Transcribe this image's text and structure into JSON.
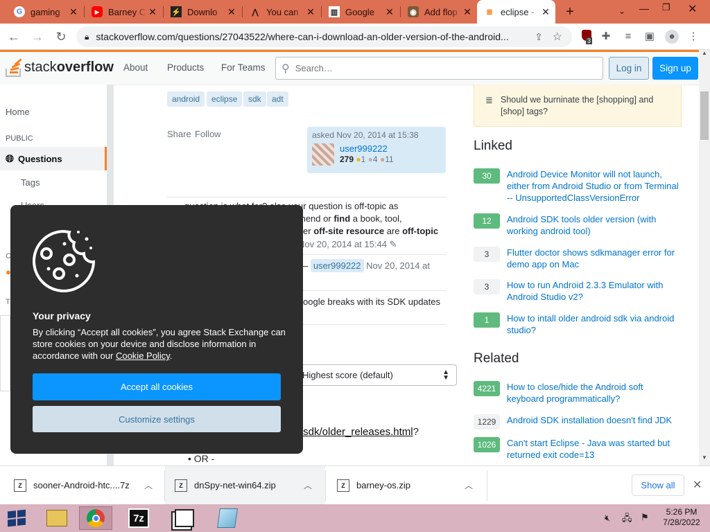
{
  "tabs": [
    {
      "title": "gaming",
      "fav": "G",
      "favcolor": "#4285f4"
    },
    {
      "title": "Barney C",
      "fav": "▶",
      "favcolor": "#ff0000"
    },
    {
      "title": "Downlo",
      "fav": "⚡",
      "favcolor": "#222"
    },
    {
      "title": "You can",
      "fav": "⋀",
      "favcolor": "#222"
    },
    {
      "title": "Google",
      "fav": "▥",
      "favcolor": "#222"
    },
    {
      "title": "Add flop",
      "fav": "◉",
      "favcolor": "#222"
    },
    {
      "title": "eclipse -",
      "fav": "≣",
      "favcolor": "#f48225",
      "active": true
    }
  ],
  "address": {
    "url": "stackoverflow.com/questions/27043522/where-can-i-download-an-older-version-of-the-android...",
    "ext_badge": "3"
  },
  "header": {
    "about": "About",
    "products": "Products",
    "teams": "For Teams",
    "search_placeholder": "Search…",
    "login": "Log in",
    "signup": "Sign up",
    "logo_light": "stack",
    "logo_bold": "overflow"
  },
  "leftnav": {
    "home": "Home",
    "public": "PUBLIC",
    "questions": "Questions",
    "tags": "Tags",
    "users": "Users"
  },
  "question": {
    "tags": [
      "android",
      "eclipse",
      "sdk",
      "adt"
    ],
    "share": "Share",
    "follow": "Follow",
    "asked": "asked Nov 20, 2014 at 15:38",
    "user": "user999222",
    "rep": "279",
    "gold": "1",
    "silver": "4",
    "bronze": "11"
  },
  "comments": {
    "c1_a": "question is what for? also your question is off-topic as",
    "c1_b": "mend or",
    "c1_find": "find",
    "c1_c": "a book, tool,",
    "c1_d": "er",
    "c1_off": "off-site resource",
    "c1_are": "are",
    "c1_ot": "off-topic",
    "c1_date": "Nov 20, 2014 at 15:44",
    "c2_user": "user999222",
    "c2_date": "Nov 20, 2014 at",
    "c3": "oogle breaks with its SDK updates"
  },
  "answers": {
    "sort": "Highest score (default)",
    "link": "/sdk/older_releases.html",
    "qmark": "?",
    "or": "OR -"
  },
  "sidebar": {
    "meta": "Should we burninate the [shopping] and [shop] tags?",
    "linked_title": "Linked",
    "linked": [
      {
        "score": "30",
        "title": "Android Device Monitor will not launch, either from Android Studio or from Terminal -- UnsupportedClassVersionError",
        "accepted": true
      },
      {
        "score": "12",
        "title": "Android SDK tools older version (with working android tool)",
        "accepted": true
      },
      {
        "score": "3",
        "title": "Flutter doctor shows sdkmanager error for demo app on Mac",
        "accepted": false
      },
      {
        "score": "3",
        "title": "How to run Android 2.3.3 Emulator with Android Studio v2?",
        "accepted": false
      },
      {
        "score": "1",
        "title": "How to intall older android sdk via android studio?",
        "accepted": true
      }
    ],
    "related_title": "Related",
    "related": [
      {
        "score": "4221",
        "title": "How to close/hide the Android soft keyboard programmatically?",
        "accepted": true
      },
      {
        "score": "1229",
        "title": "Android SDK installation doesn't find JDK",
        "accepted": false
      },
      {
        "score": "1026",
        "title": "Can't start Eclipse - Java was started but returned exit code=13",
        "accepted": true
      }
    ]
  },
  "cookie": {
    "title": "Your privacy",
    "body_a": "By clicking “Accept all cookies”, you agree Stack Exchange can store cookies on your device and disclose information in accordance with our ",
    "body_link": "Cookie Policy",
    "body_end": ".",
    "accept": "Accept all cookies",
    "customize": "Customize settings"
  },
  "downloads": [
    {
      "name": "sooner-Android-htc....7z"
    },
    {
      "name": "dnSpy-net-win64.zip"
    },
    {
      "name": "barney-os.zip"
    }
  ],
  "downloads_showall": "Show all",
  "taskbar": {
    "time": "5:26 PM",
    "date": "7/28/2022"
  }
}
